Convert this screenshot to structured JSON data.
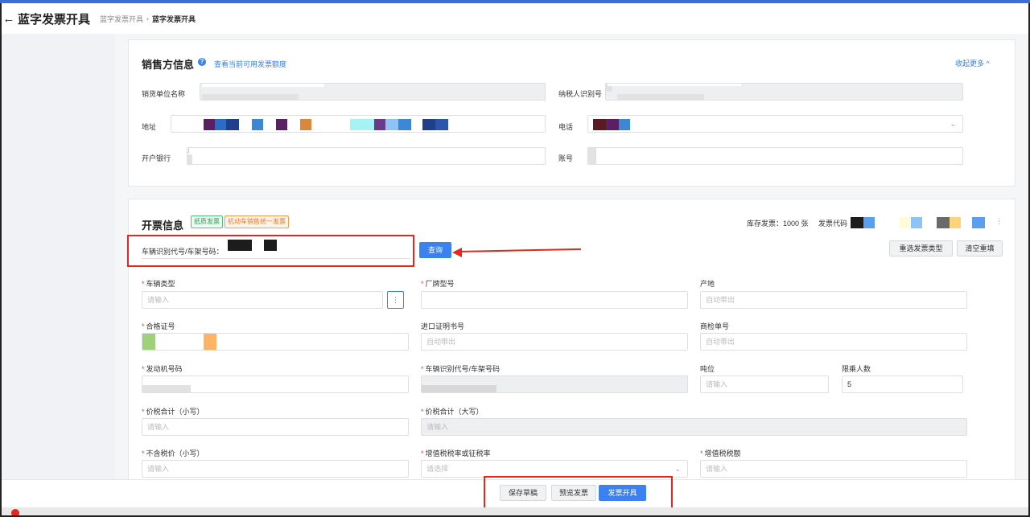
{
  "header": {
    "back_glyph": "←",
    "title": "蓝字发票开具",
    "breadcrumb": [
      "蓝字发票开具",
      "蓝字发票开具"
    ],
    "breadcrumb_sep": "›"
  },
  "seller": {
    "title": "销售方信息",
    "help_glyph": "?",
    "quota_link": "查看当前可用发票额度",
    "collapse_link": "收起更多 ^",
    "fields": {
      "name_label": "销货单位名称",
      "taxid_label": "纳税人识别号",
      "address_label": "地址",
      "phone_label": "电话",
      "bank_label": "开户银行",
      "account_label": "账号"
    }
  },
  "invoice": {
    "title": "开票信息",
    "tag_paper": "纸质发票",
    "tag_vehicle": "机动车销售统一发票",
    "stock_text": "库存发票：1000 张",
    "code_label": "发票代码",
    "vin_query_label": "车辆识别代号/车架号码：",
    "query_button": "查询",
    "reselect_button": "重选发票类型",
    "clear_button": "清空重填",
    "fields": {
      "vehicle_type": {
        "label": "车辆类型",
        "placeholder": "请输入",
        "more_glyph": "⋮"
      },
      "brand_model": {
        "label": "厂牌型号"
      },
      "origin": {
        "label": "产地",
        "placeholder": "自动带出"
      },
      "certificate": {
        "label": "合格证号"
      },
      "import_cert": {
        "label": "进口证明书号",
        "placeholder": "自动带出"
      },
      "inspection": {
        "label": "商检单号",
        "placeholder": "自动带出"
      },
      "engine_no": {
        "label": "发动机号码"
      },
      "vin": {
        "label": "车辆识别代号/车架号码"
      },
      "tonnage": {
        "label": "吨位",
        "placeholder": "请输入"
      },
      "seats": {
        "label": "限乘人数",
        "value": "5"
      },
      "total_small": {
        "label": "价税合计（小写）",
        "placeholder": "请输入"
      },
      "total_big": {
        "label": "价税合计（大写）",
        "placeholder": "请输入"
      },
      "price_ex_tax": {
        "label": "不含税价（小写）",
        "placeholder": "请输入"
      },
      "tax_rate": {
        "label": "增值税税率或征税率",
        "placeholder": "请选择"
      },
      "tax_amount": {
        "label": "增值税税额",
        "placeholder": "请输入"
      }
    },
    "required_mark": "*"
  },
  "actions": {
    "save_draft": "保存草稿",
    "preview": "预览发票",
    "issue": "发票开具"
  },
  "colors": {
    "accent": "#3b82f0",
    "annotation_red": "#e8251f",
    "required": "#e5443b"
  }
}
